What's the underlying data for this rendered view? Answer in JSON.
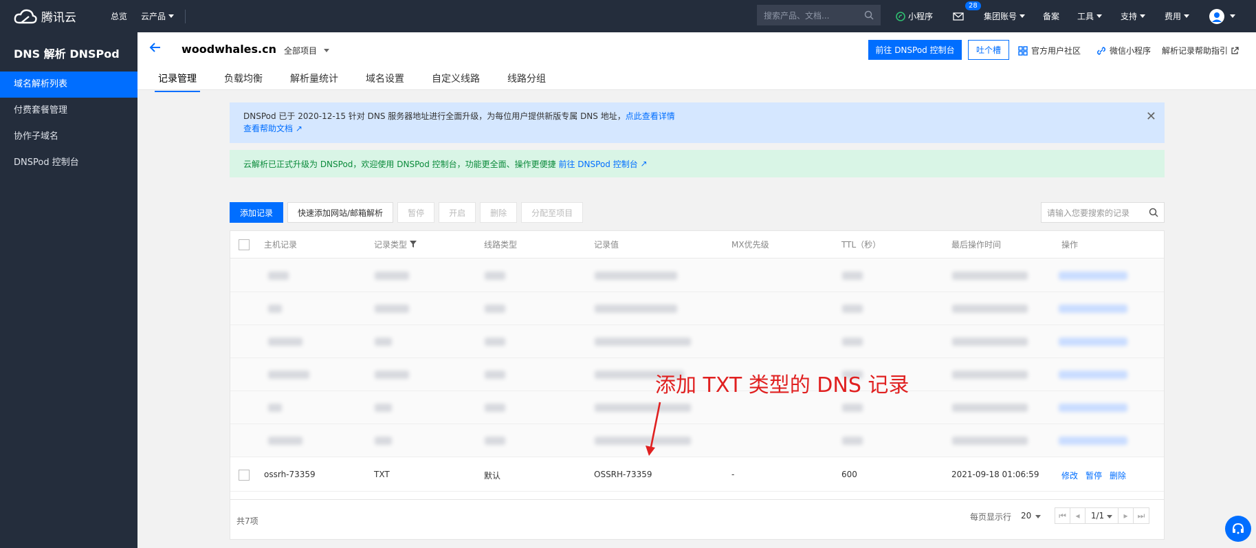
{
  "topbar": {
    "brand": "腾讯云",
    "nav": [
      "总览",
      "云产品"
    ],
    "search_placeholder": "搜索产品、文档...",
    "miniprogram": "小程序",
    "mail_count": "28",
    "group_account": "集团账号",
    "beian": "备案",
    "tools": "工具",
    "support": "支持",
    "billing": "费用"
  },
  "sidebar": {
    "title": "DNS 解析 DNSPod",
    "items": [
      {
        "label": "域名解析列表",
        "active": true
      },
      {
        "label": "付费套餐管理"
      },
      {
        "label": "协作子域名"
      },
      {
        "label": "DNSPod 控制台"
      }
    ]
  },
  "header": {
    "domain": "woodwhales.cn",
    "project": "全部项目",
    "btn_console": "前往 DNSPod 控制台",
    "btn_feedback": "吐个槽",
    "link_community": "官方用户社区",
    "link_wechat": "微信小程序",
    "link_help": "解析记录帮助指引",
    "tabs": [
      "记录管理",
      "负载均衡",
      "解析量统计",
      "域名设置",
      "自定义线路",
      "线路分组"
    ]
  },
  "alerts": {
    "blue_text": "DNSPod 已于 2020-12-15 针对 DNS 服务器地址进行全面升级，为每位用户提供新版专属 DNS 地址，",
    "blue_link": "点此查看详情",
    "blue_link2": "查看帮助文档",
    "green_text": "云解析已正式升级为 DNSPod，欢迎使用 DNSPod 控制台，功能更全面、操作更便捷",
    "green_link": "前往 DNSPod 控制台"
  },
  "toolbar": {
    "add": "添加记录",
    "quick_add": "快速添加网站/邮箱解析",
    "pause": "暂停",
    "enable": "开启",
    "delete": "删除",
    "assign": "分配至项目",
    "search_placeholder": "请输入您要搜索的记录"
  },
  "table": {
    "columns": [
      "主机记录",
      "记录类型",
      "线路类型",
      "记录值",
      "MX优先级",
      "TTL（秒）",
      "最后操作时间",
      "操作"
    ],
    "visible_row": {
      "host": "ossrh-73359",
      "type": "TXT",
      "line": "默认",
      "value": "OSSRH-73359",
      "mx": "-",
      "ttl": "600",
      "time": "2021-09-18 01:06:59",
      "actions": [
        "修改",
        "暂停",
        "删除"
      ]
    },
    "total": "共7项",
    "page_size_label": "每页显示行",
    "page_size": "20",
    "page": "1/1"
  },
  "annotation": "添加 TXT 类型的 DNS 记录"
}
